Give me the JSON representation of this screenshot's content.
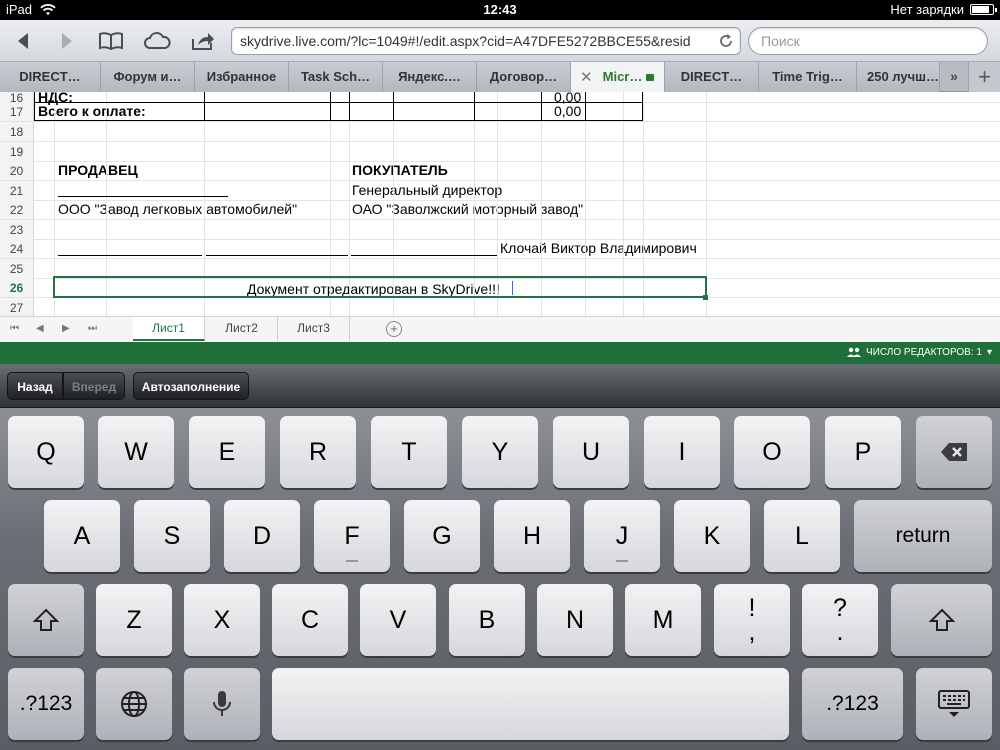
{
  "status": {
    "device": "iPad",
    "time": "12:43",
    "battery_text": "Нет зарядки",
    "battery_level": 0.85
  },
  "toolbar": {
    "url": "skydrive.live.com/?lc=1049#!/edit.aspx?cid=A47DFE5272BBCE55&resid",
    "search_placeholder": "Поиск"
  },
  "tabs": [
    {
      "label": "DIRECT…"
    },
    {
      "label": "Форум и…"
    },
    {
      "label": "Избранное"
    },
    {
      "label": "Task Sch…"
    },
    {
      "label": "Яндекс.…"
    },
    {
      "label": "Договор…"
    },
    {
      "label": "Micr…"
    },
    {
      "label": "DIRECT…"
    },
    {
      "label": "Time Trig…"
    },
    {
      "label": "250 лучш…"
    }
  ],
  "sheet": {
    "rows": [
      "16",
      "17",
      "18",
      "19",
      "20",
      "21",
      "22",
      "23",
      "24",
      "25",
      "26",
      "27"
    ],
    "row16_label": "НДС:",
    "row16_value": "0,00",
    "row17_label": "Всего к оплате:",
    "row17_value": "0,00",
    "seller_heading": "ПРОДАВЕЦ",
    "buyer_heading": "ПОКУПАТЕЛЬ",
    "buyer_position": "Генеральный директор",
    "seller_company": "ООО \"Завод легковых автомобилей\"",
    "buyer_company": "ОАО \"Заволжский моторный завод\"",
    "buyer_signatory": "Клочай Виктор Владимирович",
    "edited_message": "Документ отредактирован в SkyDrive!!!"
  },
  "sheet_tabs": [
    "Лист1",
    "Лист2",
    "Лист3"
  ],
  "editors_label": "ЧИСЛО РЕДАКТОРОВ: 1",
  "form_bar": {
    "back": "Назад",
    "forward": "Вперед",
    "autofill": "Автозаполнение"
  },
  "keyboard": {
    "row1": [
      "Q",
      "W",
      "E",
      "R",
      "T",
      "Y",
      "U",
      "I",
      "O",
      "P"
    ],
    "row2": [
      "A",
      "S",
      "D",
      "F",
      "G",
      "H",
      "J",
      "K",
      "L"
    ],
    "return": "return",
    "row3": [
      "Z",
      "X",
      "C",
      "V",
      "B",
      "N",
      "M"
    ],
    "punct1_top": "!",
    "punct1_bottom": ",",
    "punct2_top": "?",
    "punct2_bottom": ".",
    "numbers_left": ".?123",
    "numbers_right": ".?123"
  },
  "colors": {
    "excel_green": "#1e6f3a",
    "active_tab_text": "#2d7a2d"
  }
}
